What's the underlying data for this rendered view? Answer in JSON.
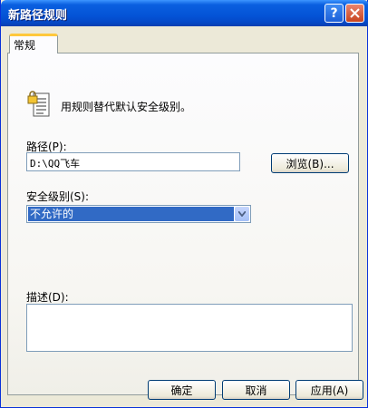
{
  "window": {
    "title": "新路径规则"
  },
  "tabs": [
    {
      "label": "常规"
    }
  ],
  "info": {
    "text": "用规则替代默认安全级别。"
  },
  "path": {
    "label": "路径(P):",
    "value": "D:\\QQ飞车",
    "browse_label": "浏览(B)..."
  },
  "security": {
    "label": "安全级别(S):",
    "selected": "不允许的"
  },
  "description": {
    "label": "描述(D):",
    "value": ""
  },
  "footer": {
    "ok_label": "确定",
    "cancel_label": "取消",
    "apply_label": "应用(A)"
  },
  "colors": {
    "title_bar": "#0453d6",
    "selection": "#316ac5",
    "tab_accent": "#ffc83c"
  }
}
